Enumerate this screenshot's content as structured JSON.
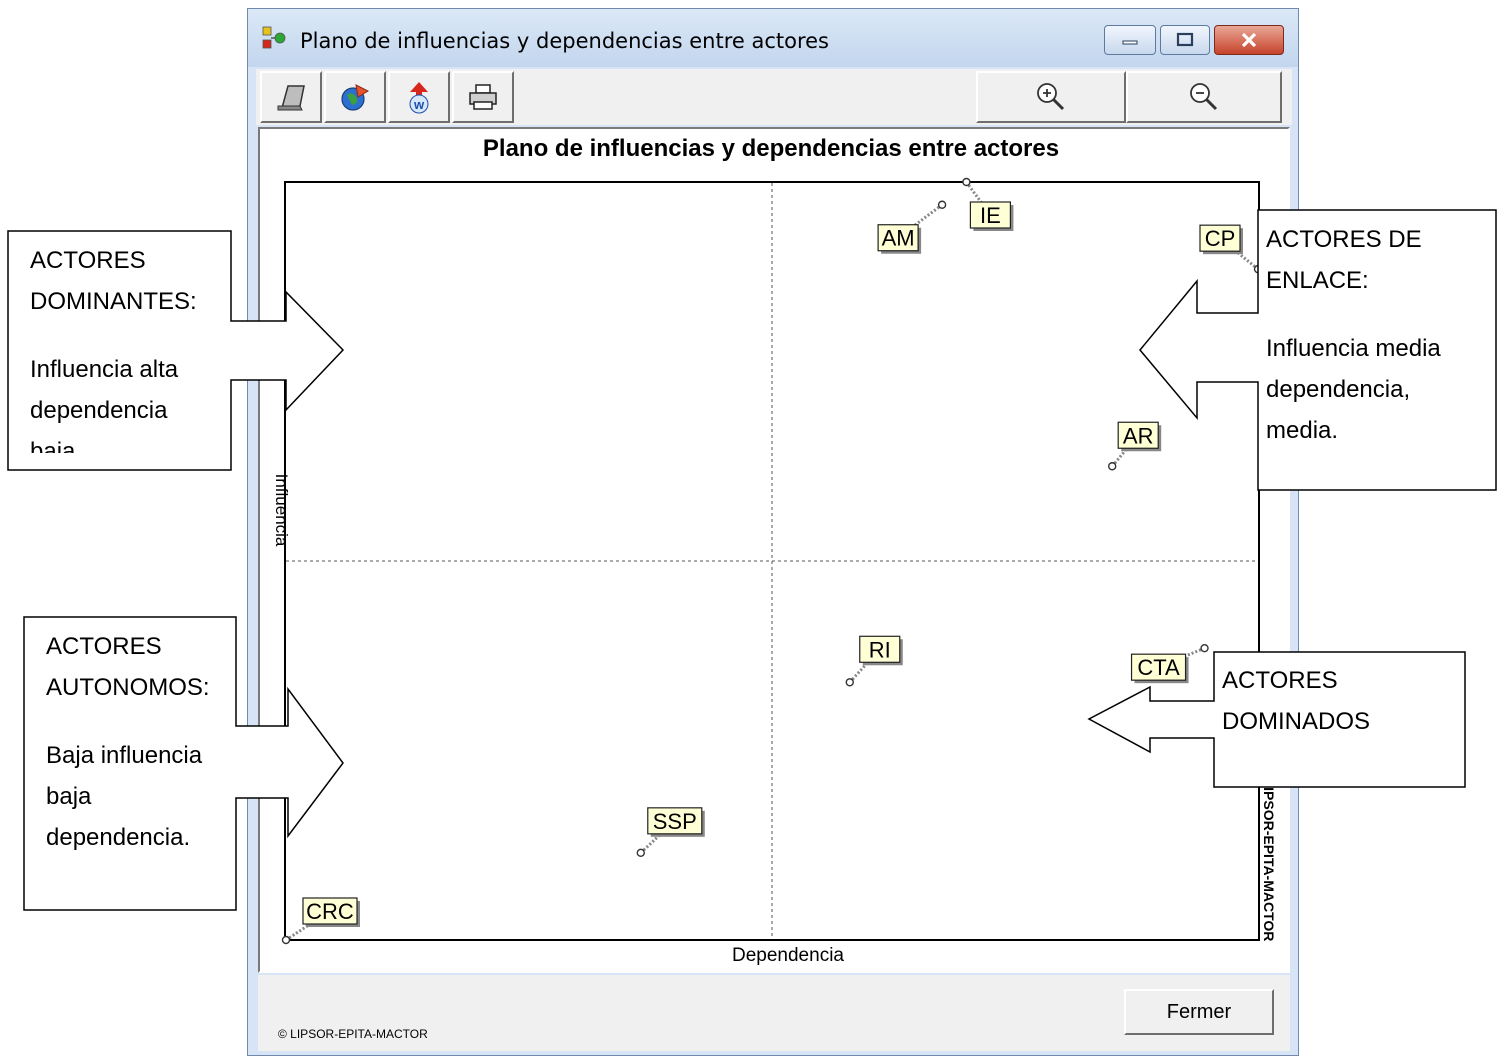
{
  "window": {
    "title": "Plano de influencias y dependencias entre actores",
    "close_button_color": "#c6432b"
  },
  "toolbar": {
    "buttons": [
      "copy-icon",
      "export-icon",
      "word-export-icon",
      "print-icon"
    ],
    "zoom_buttons": [
      "zoom-in-icon",
      "zoom-out-icon"
    ]
  },
  "footer": {
    "close_label": "Fermer",
    "copyright": "© LIPSOR-EPITA-MACTOR"
  },
  "chart_data": {
    "type": "scatter",
    "title": "Plano de influencias y dependencias entre actores",
    "xlabel": "Dependencia",
    "ylabel": "Influencia",
    "side_watermark": "LIPSOR-EPITA-MACTOR",
    "xlim": [
      0,
      100
    ],
    "ylim": [
      0,
      100
    ],
    "grid": "dashed quadrant lines at midpoint",
    "points": [
      {
        "label": "AM",
        "x": 67.5,
        "y": 97.0
      },
      {
        "label": "IE",
        "x": 70.0,
        "y": 100.0
      },
      {
        "label": "CP",
        "x": 100.0,
        "y": 88.5
      },
      {
        "label": "AR",
        "x": 85.0,
        "y": 62.5
      },
      {
        "label": "RI",
        "x": 58.0,
        "y": 34.0
      },
      {
        "label": "CTA",
        "x": 94.5,
        "y": 38.5
      },
      {
        "label": "SSP",
        "x": 36.5,
        "y": 11.5
      },
      {
        "label": "CRC",
        "x": 0.0,
        "y": 0.0
      }
    ]
  },
  "callouts": [
    {
      "id": "dominantes",
      "lines": [
        "ACTORES",
        "DOMINANTES:",
        "",
        "Influencia alta",
        "dependencia",
        "baja."
      ]
    },
    {
      "id": "enlace",
      "lines": [
        "ACTORES DE",
        "ENLACE:",
        "",
        "Influencia media",
        "dependencia,",
        "media."
      ]
    },
    {
      "id": "autonomos",
      "lines": [
        "ACTORES",
        "AUTONOMOS:",
        "",
        "Baja influencia",
        "baja",
        "dependencia."
      ]
    },
    {
      "id": "dominados",
      "lines": [
        "ACTORES",
        "DOMINADOS"
      ]
    }
  ]
}
